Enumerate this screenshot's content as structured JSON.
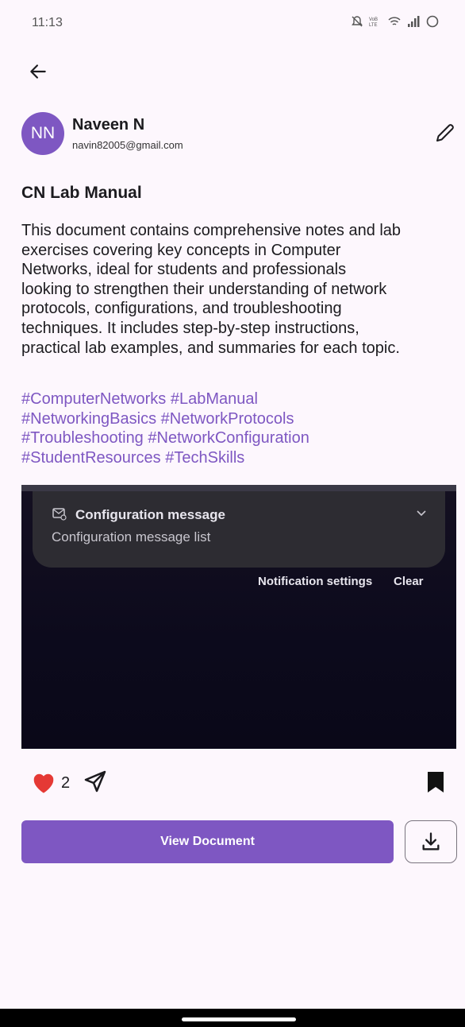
{
  "status_bar": {
    "time": "11:13",
    "icons": [
      "mute-icon",
      "volte-icon",
      "wifi-icon",
      "signal-icon",
      "battery-icon"
    ]
  },
  "header": {
    "back_icon": "arrow-left-icon"
  },
  "author": {
    "initials": "NN",
    "name": "Naveen N",
    "email": "navin82005@gmail.com",
    "avatar_color": "#7e57c2"
  },
  "document": {
    "title": "CN Lab Manual",
    "description_lines": [
      "This document contains comprehensive notes and lab",
      "exercises covering key concepts in Computer",
      "Networks, ideal for students and professionals",
      "looking to strengthen their understanding of network",
      "protocols, configurations, and troubleshooting",
      "techniques. It includes step-by-step instructions,",
      "practical lab examples, and summaries for each topic."
    ],
    "tags": [
      "#ComputerNetworks",
      "#LabManual",
      "#NetworkingBasics",
      "#NetworkProtocols",
      "#Troubleshooting",
      "#NetworkConfiguration",
      "#StudentResources",
      "#TechSkills"
    ],
    "tag_color": "#7e57c2"
  },
  "preview": {
    "notification_title": "Configuration message",
    "notification_subtitle": "Configuration message list",
    "settings_label": "Notification settings",
    "clear_label": "Clear"
  },
  "actions": {
    "like_count": "2",
    "like_color": "#e53935",
    "view_document_label": "View Document",
    "accent": "#7e57c2"
  }
}
